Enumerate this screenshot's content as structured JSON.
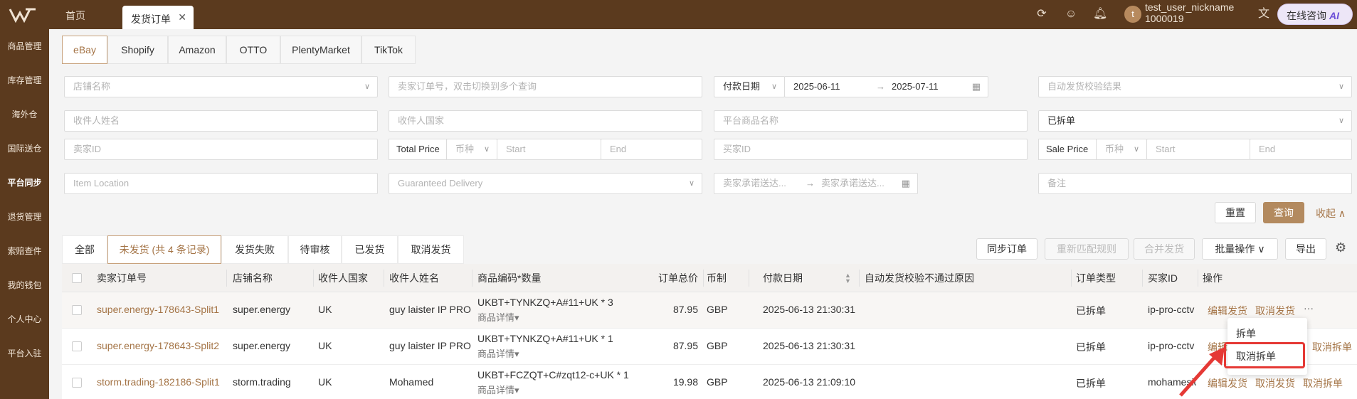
{
  "topbar": {
    "tabs": [
      {
        "label": "首页"
      },
      {
        "label": "发货订单"
      }
    ],
    "close_glyph": "✕",
    "user_nickname": "test_user_nickname",
    "user_id": "1000019",
    "avatar_letter": "t",
    "ai_label": "在线咨询",
    "ai_badge": "AI",
    "icons": [
      "refresh-icon",
      "smile-icon",
      "bell-icon",
      "translate-icon"
    ]
  },
  "sidebar": {
    "items": [
      {
        "label": "商品管理"
      },
      {
        "label": "库存管理"
      },
      {
        "label": "海外仓"
      },
      {
        "label": "国际送仓"
      },
      {
        "label": "平台同步"
      },
      {
        "label": "退货管理"
      },
      {
        "label": "索赔查件"
      },
      {
        "label": "我的钱包"
      },
      {
        "label": "个人中心"
      },
      {
        "label": "平台入驻"
      }
    ],
    "active_index": 4
  },
  "platform_tabs": [
    {
      "label": "eBay"
    },
    {
      "label": "Shopify"
    },
    {
      "label": "Amazon"
    },
    {
      "label": "OTTO"
    },
    {
      "label": "PlentyMarket"
    },
    {
      "label": "TikTok"
    }
  ],
  "filters": {
    "store_name": "店铺名称",
    "seller_order_no": "卖家订单号，双击切换到多个查询",
    "date_type": "付款日期",
    "date_start": "2025-06-11",
    "date_end": "2025-07-11",
    "auto_check": "自动发货校验结果",
    "recipient_name": "收件人姓名",
    "recipient_country": "收件人国家",
    "platform_product": "平台商品名称",
    "split_status": "已拆单",
    "seller_id": "卖家ID",
    "total_price_label": "Total Price",
    "currency": "币种",
    "start": "Start",
    "end": "End",
    "buyer_id": "买家ID",
    "sale_price_label": "Sale Price",
    "item_location": "Item Location",
    "guaranteed_delivery": "Guaranteed Delivery",
    "promise_start": "卖家承诺送达...",
    "promise_end": "卖家承诺送达...",
    "remark": "备注",
    "arrow": "→"
  },
  "actions": {
    "reset": "重置",
    "query": "查询",
    "collapse": "收起"
  },
  "status_tabs": [
    {
      "label": "全部"
    },
    {
      "label": "未发货 (共 4 条记录)"
    },
    {
      "label": "发货失败"
    },
    {
      "label": "待审核"
    },
    {
      "label": "已发货"
    },
    {
      "label": "取消发货"
    }
  ],
  "toolbar": {
    "sync": "同步订单",
    "rematch": "重新匹配规则",
    "merge": "合并发货",
    "batch": "批量操作",
    "export": "导出"
  },
  "table": {
    "columns": [
      "卖家订单号",
      "店铺名称",
      "收件人国家",
      "收件人姓名",
      "商品编码*数量",
      "订单总价",
      "币制",
      "付款日期",
      "自动发货校验不通过原因",
      "订单类型",
      "买家ID",
      "操作"
    ],
    "product_detail": "商品详情",
    "rows": [
      {
        "order_no": "super.energy-178643-Split1",
        "store": "super.energy",
        "country": "UK",
        "name": "guy laister IP PRO",
        "product": "UKBT+TYNKZQ+A#11+UK * 3",
        "total": "87.95",
        "currency": "GBP",
        "paid": "2025-06-13 21:30:31",
        "reason": "",
        "type": "已拆单",
        "buyer": "ip-pro-cctv"
      },
      {
        "order_no": "super.energy-178643-Split2",
        "store": "super.energy",
        "country": "UK",
        "name": "guy laister IP PRO",
        "product": "UKBT+TYNKZQ+A#11+UK * 1",
        "total": "87.95",
        "currency": "GBP",
        "paid": "2025-06-13 21:30:31",
        "reason": "",
        "type": "已拆单",
        "buyer": "ip-pro-cctv"
      },
      {
        "order_no": "storm.trading-182186-Split1",
        "store": "storm.trading",
        "country": "UK",
        "name": "Mohamed",
        "product": "UKBT+FCZQT+C#zqt12-c+UK * 1",
        "total": "19.98",
        "currency": "GBP",
        "paid": "2025-06-13 21:09:10",
        "reason": "",
        "type": "已拆单",
        "buyer": "mohamesio"
      }
    ],
    "ops": {
      "edit": "编辑发货",
      "cancel": "取消发货",
      "cancel_split": "取消拆单",
      "more": "···",
      "edit_partial": "编辑"
    },
    "more_menu": [
      "拆单",
      "取消拆单"
    ]
  },
  "colors": {
    "brand": "#5b3a1e",
    "accent": "#a47446",
    "primary_button": "#b38a5f",
    "highlight": "#e53935"
  }
}
